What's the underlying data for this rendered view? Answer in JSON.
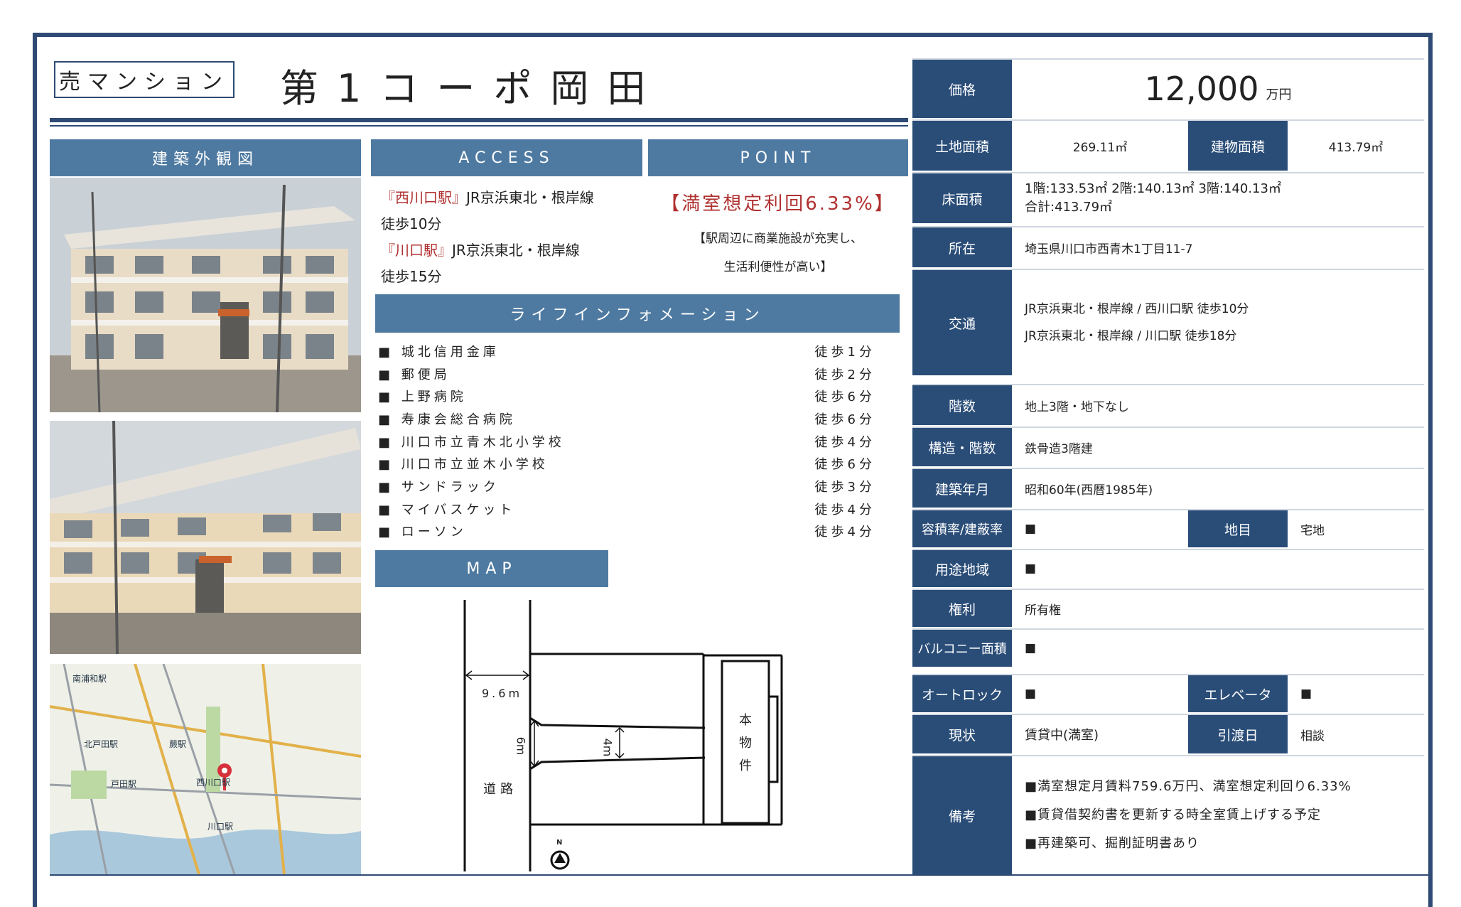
{
  "header": {
    "type_badge": "売マンション",
    "title": "第1コーポ岡田"
  },
  "sections": {
    "exterior": "建築外観図",
    "access": "ACCESS",
    "point": "POINT",
    "life": "ライフインフォメーション",
    "map": "MAP"
  },
  "access": {
    "line1_station": "『西川口駅』",
    "line1_rest": "JR京浜東北・根岸線",
    "line1_walk": "徒歩10分",
    "line2_station": "『川口駅』",
    "line2_rest": "JR京浜東北・根岸線",
    "line2_walk": "徒歩15分"
  },
  "point": {
    "headline": "【満室想定利回6.33%】",
    "body1": "【駅周辺に商業施設が充実し、",
    "body2": "生活利便性が高い】"
  },
  "life_info": [
    {
      "name": "■ 城北信用金庫",
      "walk": "徒歩1分"
    },
    {
      "name": "■ 郵便局",
      "walk": "徒歩2分"
    },
    {
      "name": "■ 上野病院",
      "walk": "徒歩6分"
    },
    {
      "name": "■ 寿康会総合病院",
      "walk": "徒歩6分"
    },
    {
      "name": "■ 川口市立青木北小学校",
      "walk": "徒歩4分"
    },
    {
      "name": "■ 川口市立並木小学校",
      "walk": "徒歩6分"
    },
    {
      "name": "■ サンドラック",
      "walk": "徒歩3分"
    },
    {
      "name": "■ マイバスケット",
      "walk": "徒歩4分"
    },
    {
      "name": "■ ローソン",
      "walk": "徒歩4分"
    }
  ],
  "site_map": {
    "road_width": "9.6m",
    "frontage_left": "6m",
    "frontage_right": "4m",
    "road_label": "道路",
    "property": "本物件",
    "north": "N"
  },
  "map_labels": {
    "s1": "南浦和駅",
    "s2": "北戸田駅",
    "s3": "蕨駅",
    "s4": "西川口駅",
    "s5": "戸田駅",
    "s6": "川口駅"
  },
  "details": {
    "price_label": "価格",
    "price": "12,000",
    "price_unit": "万円",
    "land_label": "土地面積",
    "land": "269.11㎡",
    "bldg_label": "建物面積",
    "bldg": "413.79㎡",
    "floor_label": "床面積",
    "floor1": "1階:133.53㎡ 2階:140.13㎡ 3階:140.13㎡",
    "floor2": "合計:413.79㎡",
    "addr_label": "所在",
    "addr": "埼玉県川口市西青木1丁目11-7",
    "transit_label": "交通",
    "transit1": "JR京浜東北・根岸線 / 西川口駅 徒歩10分",
    "transit2": "JR京浜東北・根岸線 / 川口駅 徒歩18分",
    "stories_label": "階数",
    "stories": "地上3階・地下なし",
    "struct_label": "構造・階数",
    "struct": "鉄骨造3階建",
    "built_label": "建築年月",
    "built": "昭和60年(西暦1985年)",
    "far_label": "容積率/建蔽率",
    "far": "■",
    "chimoku_label": "地目",
    "chimoku": "宅地",
    "zone_label": "用途地域",
    "zone": "■",
    "right_label": "権利",
    "right": "所有権",
    "balcony_label": "バルコニー面積",
    "balcony": "■",
    "autolock_label": "オートロック",
    "autolock": "■",
    "elevator_label": "エレベータ",
    "elevator": "■",
    "status_label": "現状",
    "status": "賃貸中(満室)",
    "handover_label": "引渡日",
    "handover": "相談",
    "notes_label": "備考",
    "note1": "■満室想定月賃料759.6万円、満室想定利回り6.33%",
    "note2": "■賃貸借契約書を更新する時全室賃上げする予定",
    "note3": "■再建築可、掘削証明書あり"
  },
  "colors": {
    "navy": "#2a4d78",
    "section_blue": "#4e7aa1",
    "accent_red": "#b03030"
  }
}
